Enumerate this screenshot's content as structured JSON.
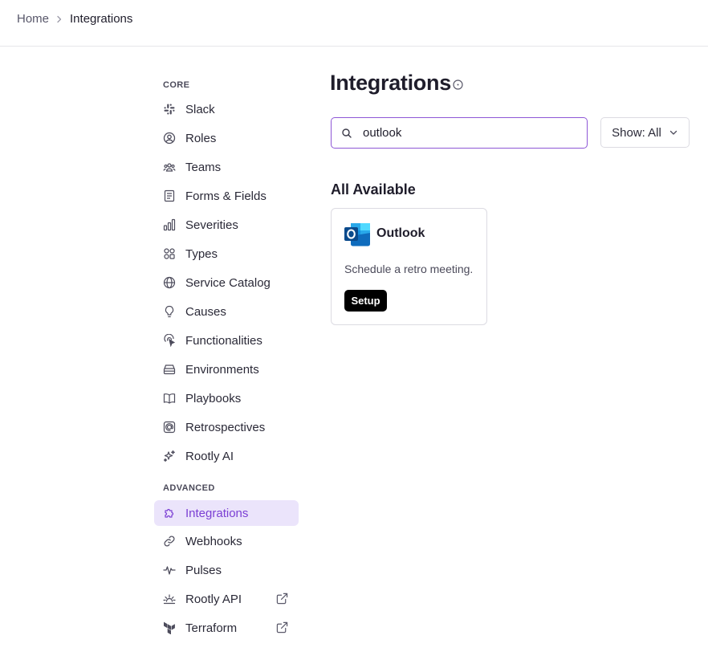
{
  "breadcrumb": {
    "home": "Home",
    "current": "Integrations"
  },
  "sidebar": {
    "core_label": "CORE",
    "advanced_label": "ADVANCED",
    "core_items": [
      {
        "label": "Slack",
        "icon": "slack-icon"
      },
      {
        "label": "Roles",
        "icon": "user-circle-icon"
      },
      {
        "label": "Teams",
        "icon": "users-icon"
      },
      {
        "label": "Forms & Fields",
        "icon": "form-icon"
      },
      {
        "label": "Severities",
        "icon": "bar-chart-icon"
      },
      {
        "label": "Types",
        "icon": "shapes-icon"
      },
      {
        "label": "Service Catalog",
        "icon": "globe-icon"
      },
      {
        "label": "Causes",
        "icon": "lightbulb-icon"
      },
      {
        "label": "Functionalities",
        "icon": "pointer-icon"
      },
      {
        "label": "Environments",
        "icon": "server-icon"
      },
      {
        "label": "Playbooks",
        "icon": "book-icon"
      },
      {
        "label": "Retrospectives",
        "icon": "at-sign-icon"
      },
      {
        "label": "Rootly AI",
        "icon": "sparkles-icon"
      }
    ],
    "advanced_items": [
      {
        "label": "Integrations",
        "icon": "puzzle-icon",
        "active": true
      },
      {
        "label": "Webhooks",
        "icon": "link-icon"
      },
      {
        "label": "Pulses",
        "icon": "activity-icon"
      },
      {
        "label": "Rootly API",
        "icon": "sunrise-icon",
        "external": true
      },
      {
        "label": "Terraform",
        "icon": "terraform-icon",
        "external": true
      }
    ]
  },
  "main": {
    "title": "Integrations",
    "search": {
      "value": "outlook"
    },
    "filter": {
      "label": "Show: All"
    },
    "section_heading": "All Available",
    "cards": [
      {
        "name": "Outlook",
        "description": "Schedule a retro meeting.",
        "button": "Setup",
        "icon": "outlook-logo"
      }
    ]
  },
  "colors": {
    "accent": "#7b3fd4",
    "active_bg": "#ebe4fb",
    "search_border": "#8e57d6",
    "outlook_blue": "#0f6cbd",
    "outlook_dark": "#0a4a8c",
    "button_bg": "#000000"
  }
}
